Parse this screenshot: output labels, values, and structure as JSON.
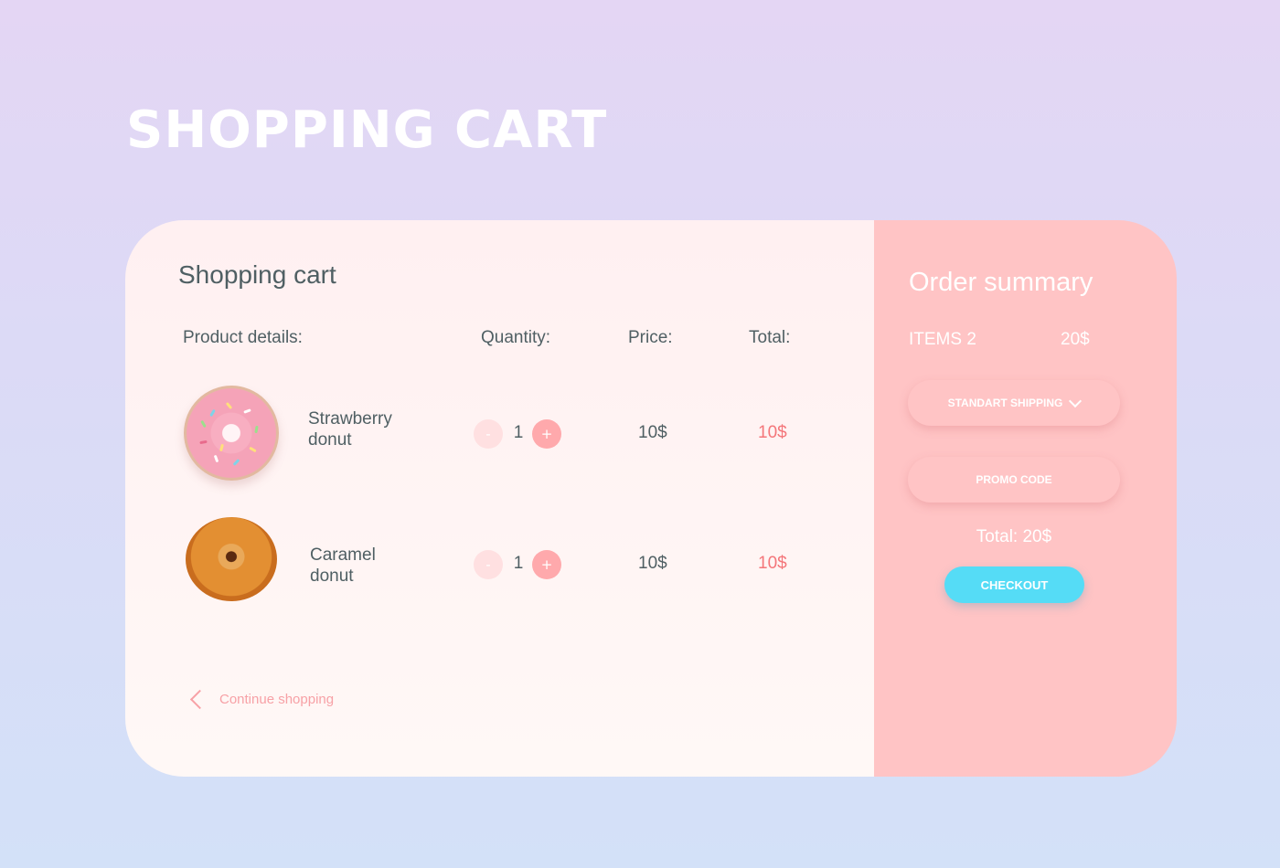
{
  "page": {
    "title": "SHOPPING CART"
  },
  "cart": {
    "heading": "Shopping cart",
    "columns": {
      "product": "Product details:",
      "quantity": "Quantity:",
      "price": "Price:",
      "total": "Total:"
    },
    "items": [
      {
        "name_line1": "Strawberry",
        "name_line2": "donut",
        "image_icon": "strawberry-donut-image",
        "minus_label": "-",
        "plus_label": "+",
        "quantity": "1",
        "price": "10$",
        "total": "10$"
      },
      {
        "name_line1": "Caramel",
        "name_line2": "donut",
        "image_icon": "caramel-donut-image",
        "minus_label": "-",
        "plus_label": "+",
        "quantity": "1",
        "price": "10$",
        "total": "10$"
      }
    ],
    "continue_label": "Continue shopping",
    "continue_icon": "chevron-left-icon"
  },
  "summary": {
    "heading": "Order summary",
    "items_label": "ITEMS 2",
    "items_total": "20$",
    "shipping_label": "STANDART SHIPPING",
    "shipping_icon": "chevron-down-icon",
    "promo_label": "PROMO CODE",
    "total_label": "Total: 20$",
    "checkout_label": "CHECKOUT"
  },
  "colors": {
    "background_top": "#e4d6f4",
    "background_bottom": "#d3e1f8",
    "summary_panel": "#ffc4c5",
    "accent_price": "#f4767a",
    "checkout": "#55dcf6",
    "text_primary": "#4f5f63"
  }
}
